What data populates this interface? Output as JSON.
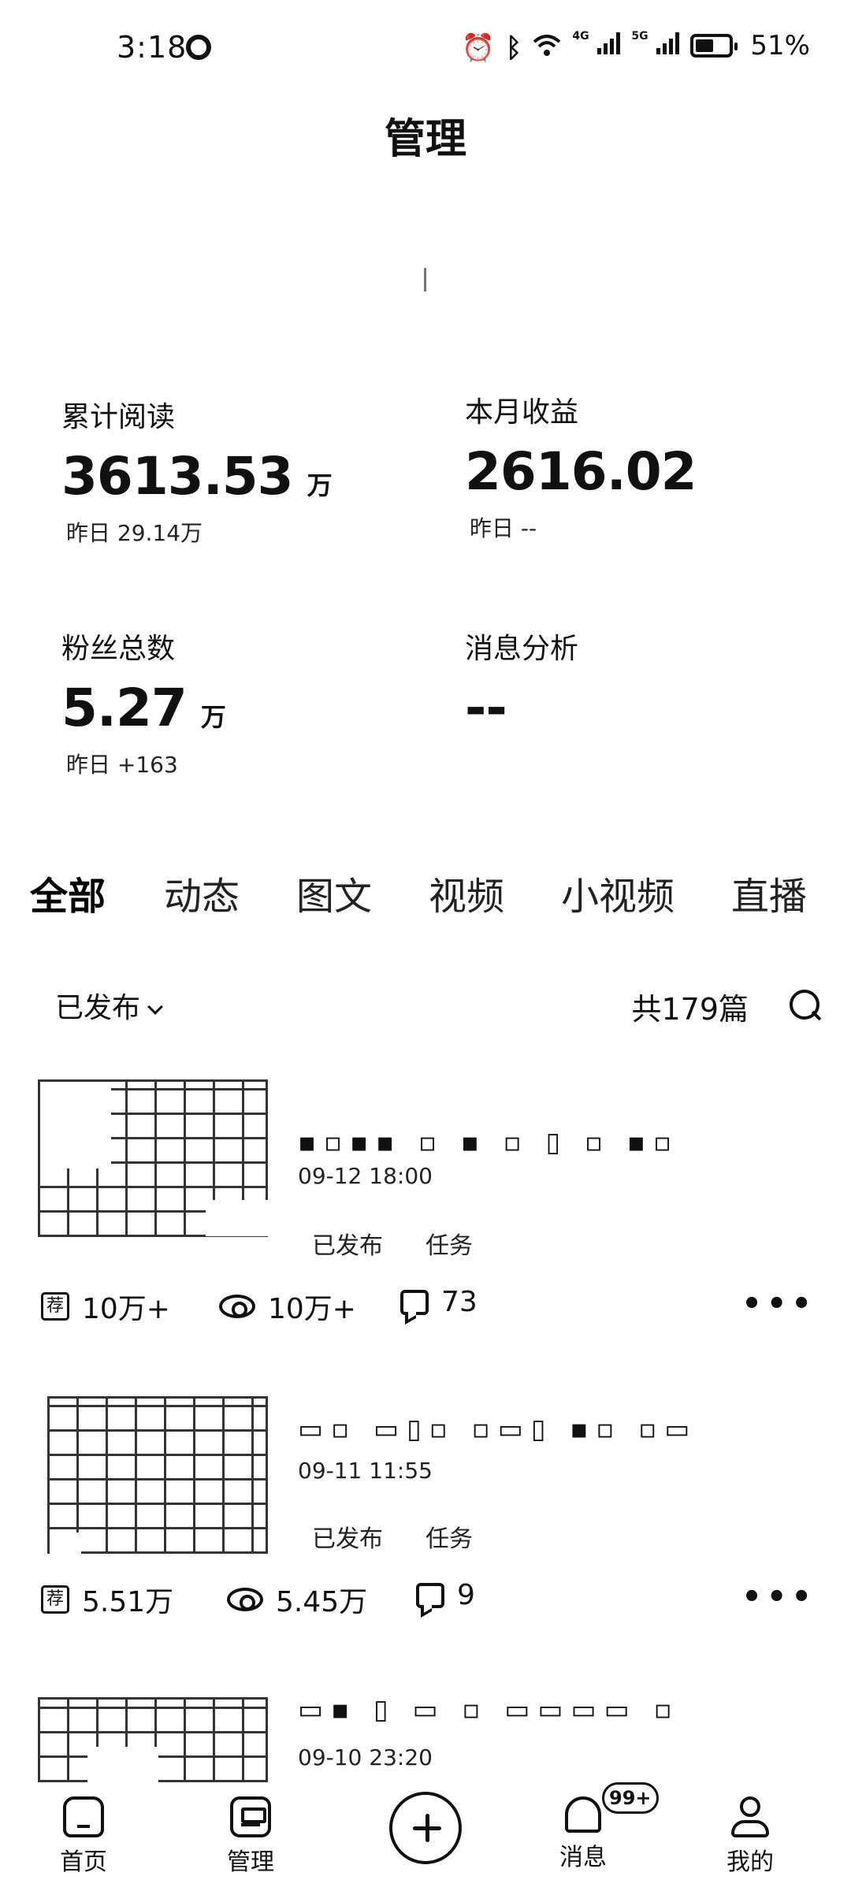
{
  "status_bar": {
    "time": "3:18",
    "network_4g": "4G",
    "network_5g": "5G",
    "battery": "51%"
  },
  "header": {
    "title": "管理"
  },
  "stats": {
    "total_reads": {
      "label": "累计阅读",
      "value": "3613.53",
      "unit": "万",
      "sub": "昨日 29.14万"
    },
    "monthly_income": {
      "label": "本月收益",
      "value": "2616.02",
      "sub": "昨日 --"
    },
    "followers": {
      "label": "粉丝总数",
      "value": "5.27",
      "unit": "万",
      "sub": "昨日 +163"
    },
    "message_analysis": {
      "label": "消息分析",
      "value": "--"
    }
  },
  "tabs": [
    "全部",
    "动态",
    "图文",
    "视频",
    "小视频",
    "直播"
  ],
  "active_tab": "全部",
  "filter": {
    "status": "已发布",
    "count": "共179篇"
  },
  "articles": [
    {
      "date": "09-12 18:00",
      "tags": [
        "已发布",
        "任务"
      ],
      "recommend": "10万+",
      "views": "10万+",
      "comments": "73"
    },
    {
      "date": "09-11 11:55",
      "tags": [
        "已发布",
        "任务"
      ],
      "recommend": "5.51万",
      "views": "5.45万",
      "comments": "9"
    },
    {
      "date": "09-10 23:20"
    }
  ],
  "bottom_nav": {
    "home": "首页",
    "manage": "管理",
    "messages": "消息",
    "mine": "我的",
    "message_badge": "99+"
  },
  "more_glyph": "•••"
}
